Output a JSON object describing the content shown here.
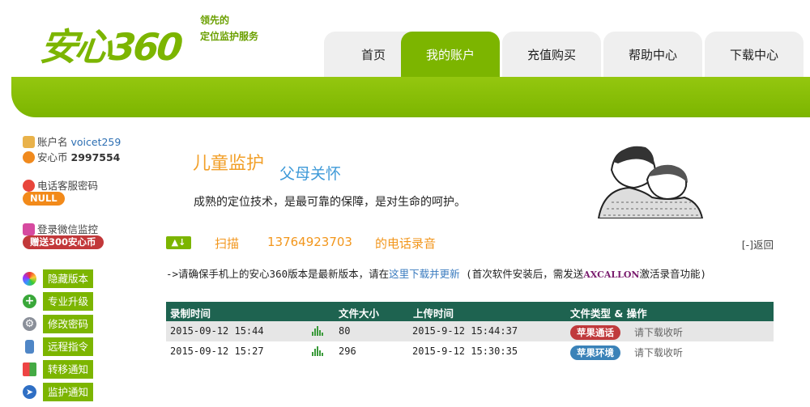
{
  "header": {
    "logo_text": "安心360",
    "slogan_line1": "领先的",
    "slogan_line2": "定位监护服务"
  },
  "nav": {
    "items": [
      {
        "label": "首页",
        "active": false
      },
      {
        "label": "我的账户",
        "active": true
      },
      {
        "label": "充值购买",
        "active": false
      },
      {
        "label": "帮助中心",
        "active": false
      },
      {
        "label": "下载中心",
        "active": false
      }
    ]
  },
  "sidebar": {
    "account_label": "账户名",
    "account_value": "voicet259",
    "coin_label": "安心币",
    "coin_value": "2997554",
    "phone_pw_label": "电话客服密码",
    "phone_pw_value": "NULL",
    "wechat_label": "登录微信监控",
    "wechat_badge": "赠送300安心币",
    "menu": [
      {
        "label": "隐藏版本",
        "icon": "color-wheel-icon"
      },
      {
        "label": "专业升级",
        "icon": "plus-icon"
      },
      {
        "label": "修改密码",
        "icon": "gear-icon"
      },
      {
        "label": "远程指令",
        "icon": "phone-icon"
      },
      {
        "label": "转移通知",
        "icon": "grid-icon"
      },
      {
        "label": "监护通知",
        "icon": "compass-icon"
      }
    ]
  },
  "banner": {
    "title1": "儿童监护",
    "title2": "父母关怀",
    "description": "成熟的定位技术，是最可靠的保障，是对生命的呵护。"
  },
  "scan": {
    "label": "扫描",
    "phone": "13764923703",
    "suffix": "的电话录音",
    "back": "[-]返回"
  },
  "notice": {
    "prefix": "->请确保手机上的安心360版本是最新版本，请在",
    "link": "这里下载并更新",
    "middle": "  (首次软件安装后，需发送",
    "code": "AXCALLON",
    "suffix": "激活录音功能)"
  },
  "table": {
    "headers": {
      "time": "录制时间",
      "size": "文件大小",
      "upload": "上传时间",
      "type": "文件类型 & 操作"
    },
    "rows": [
      {
        "time": "2015-09-12 15:44",
        "size": "80",
        "upload": "2015-9-12 15:44:37",
        "type": "苹果通话",
        "type_color": "#c03a3c",
        "action": "请下载收听"
      },
      {
        "time": "2015-09-12 15:27",
        "size": "296",
        "upload": "2015-9-12 15:30:35",
        "type": "苹果环境",
        "type_color": "#3a82b8",
        "action": "请下载收听"
      }
    ]
  },
  "colors": {
    "brand_green": "#7cb500",
    "table_header": "#1e6350",
    "accent_orange": "#f2961c"
  }
}
